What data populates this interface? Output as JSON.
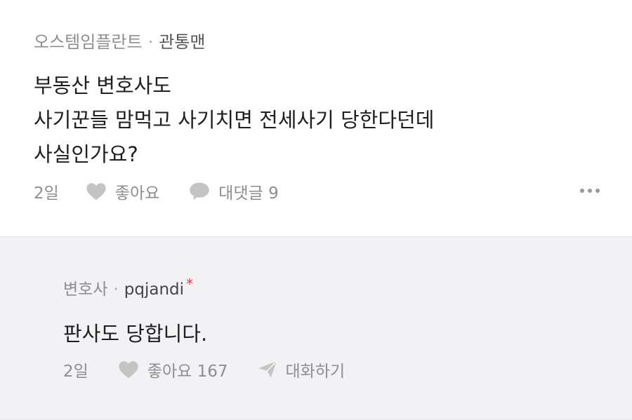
{
  "post": {
    "board": "오스템임플란트",
    "separator": "·",
    "author": "관통맨",
    "lines": [
      "부동산 변호사도",
      "사기꾼들 맘먹고 사기치면 전세사기 당한다던데",
      "사실인가요?"
    ],
    "time": "2일",
    "like_label": "좋아요",
    "reply_label": "대댓글 9"
  },
  "reply": {
    "role": "변호사",
    "separator": "·",
    "author": "pqjandi",
    "badge": "*",
    "text": "판사도 당합니다.",
    "time": "2일",
    "like_label": "좋아요 167",
    "chat_label": "대화하기"
  },
  "icons": {
    "like": "heart-icon",
    "comment": "speech-bubble-icon",
    "chat": "send-arrow-icon",
    "more": "more-dots-icon"
  },
  "colors": {
    "meta_text": "#8e8e8e",
    "body_text": "#1f1f1f",
    "reply_background": "#f2f2f4",
    "author_badge": "#e0404a"
  }
}
